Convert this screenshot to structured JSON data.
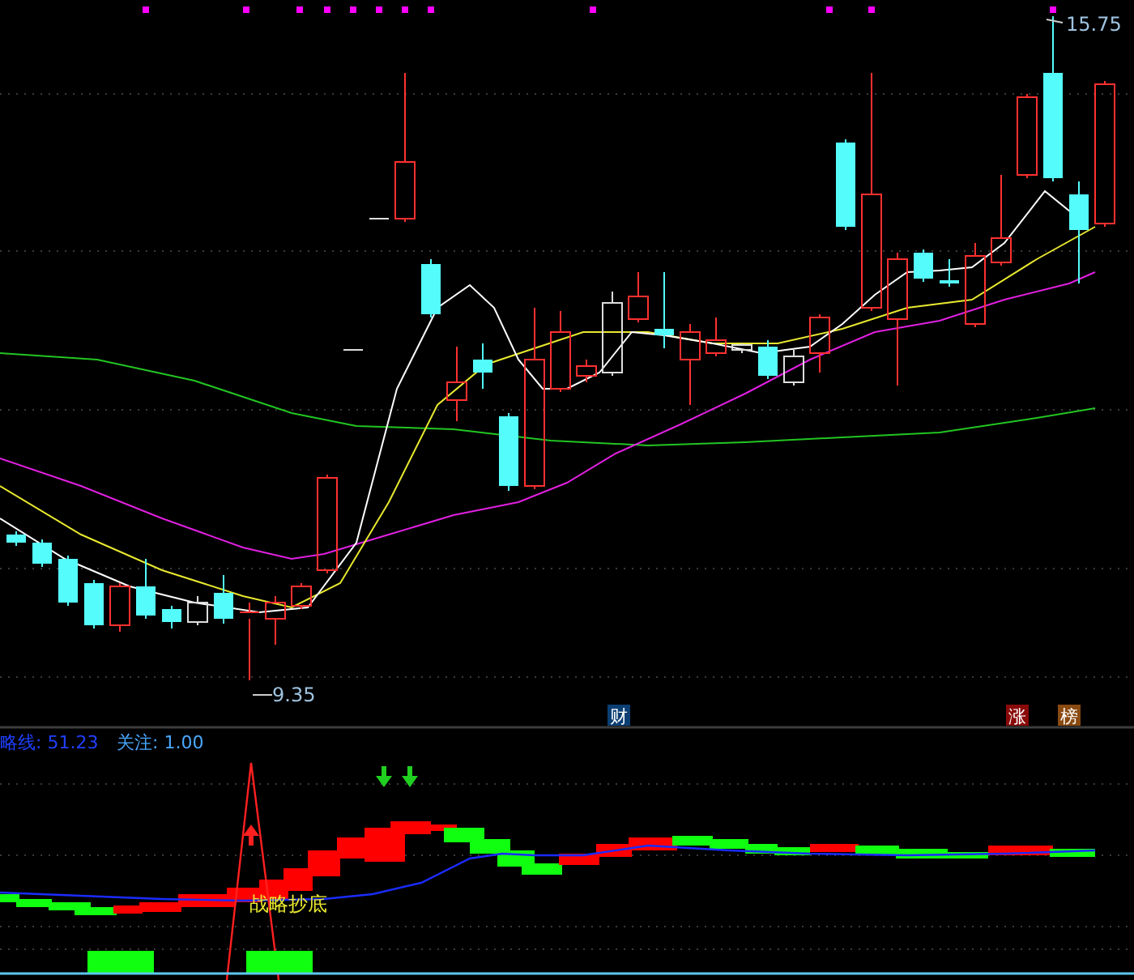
{
  "price_panel": {
    "high_label": "15.75",
    "low_label": "9.35",
    "markers": [
      {
        "text": "财",
        "color": "#0b3f74"
      },
      {
        "text": "涨",
        "color": "#8a0a0a"
      },
      {
        "text": "榜",
        "color": "#8a4a10"
      }
    ]
  },
  "indicator_panel": {
    "legend": [
      {
        "label": "略线:",
        "value": "51.23",
        "color": "#2040ff"
      },
      {
        "label": "关注:",
        "value": "1.00",
        "color": "#4aa8ff"
      }
    ],
    "signal_label": "战略抄底"
  }
}
